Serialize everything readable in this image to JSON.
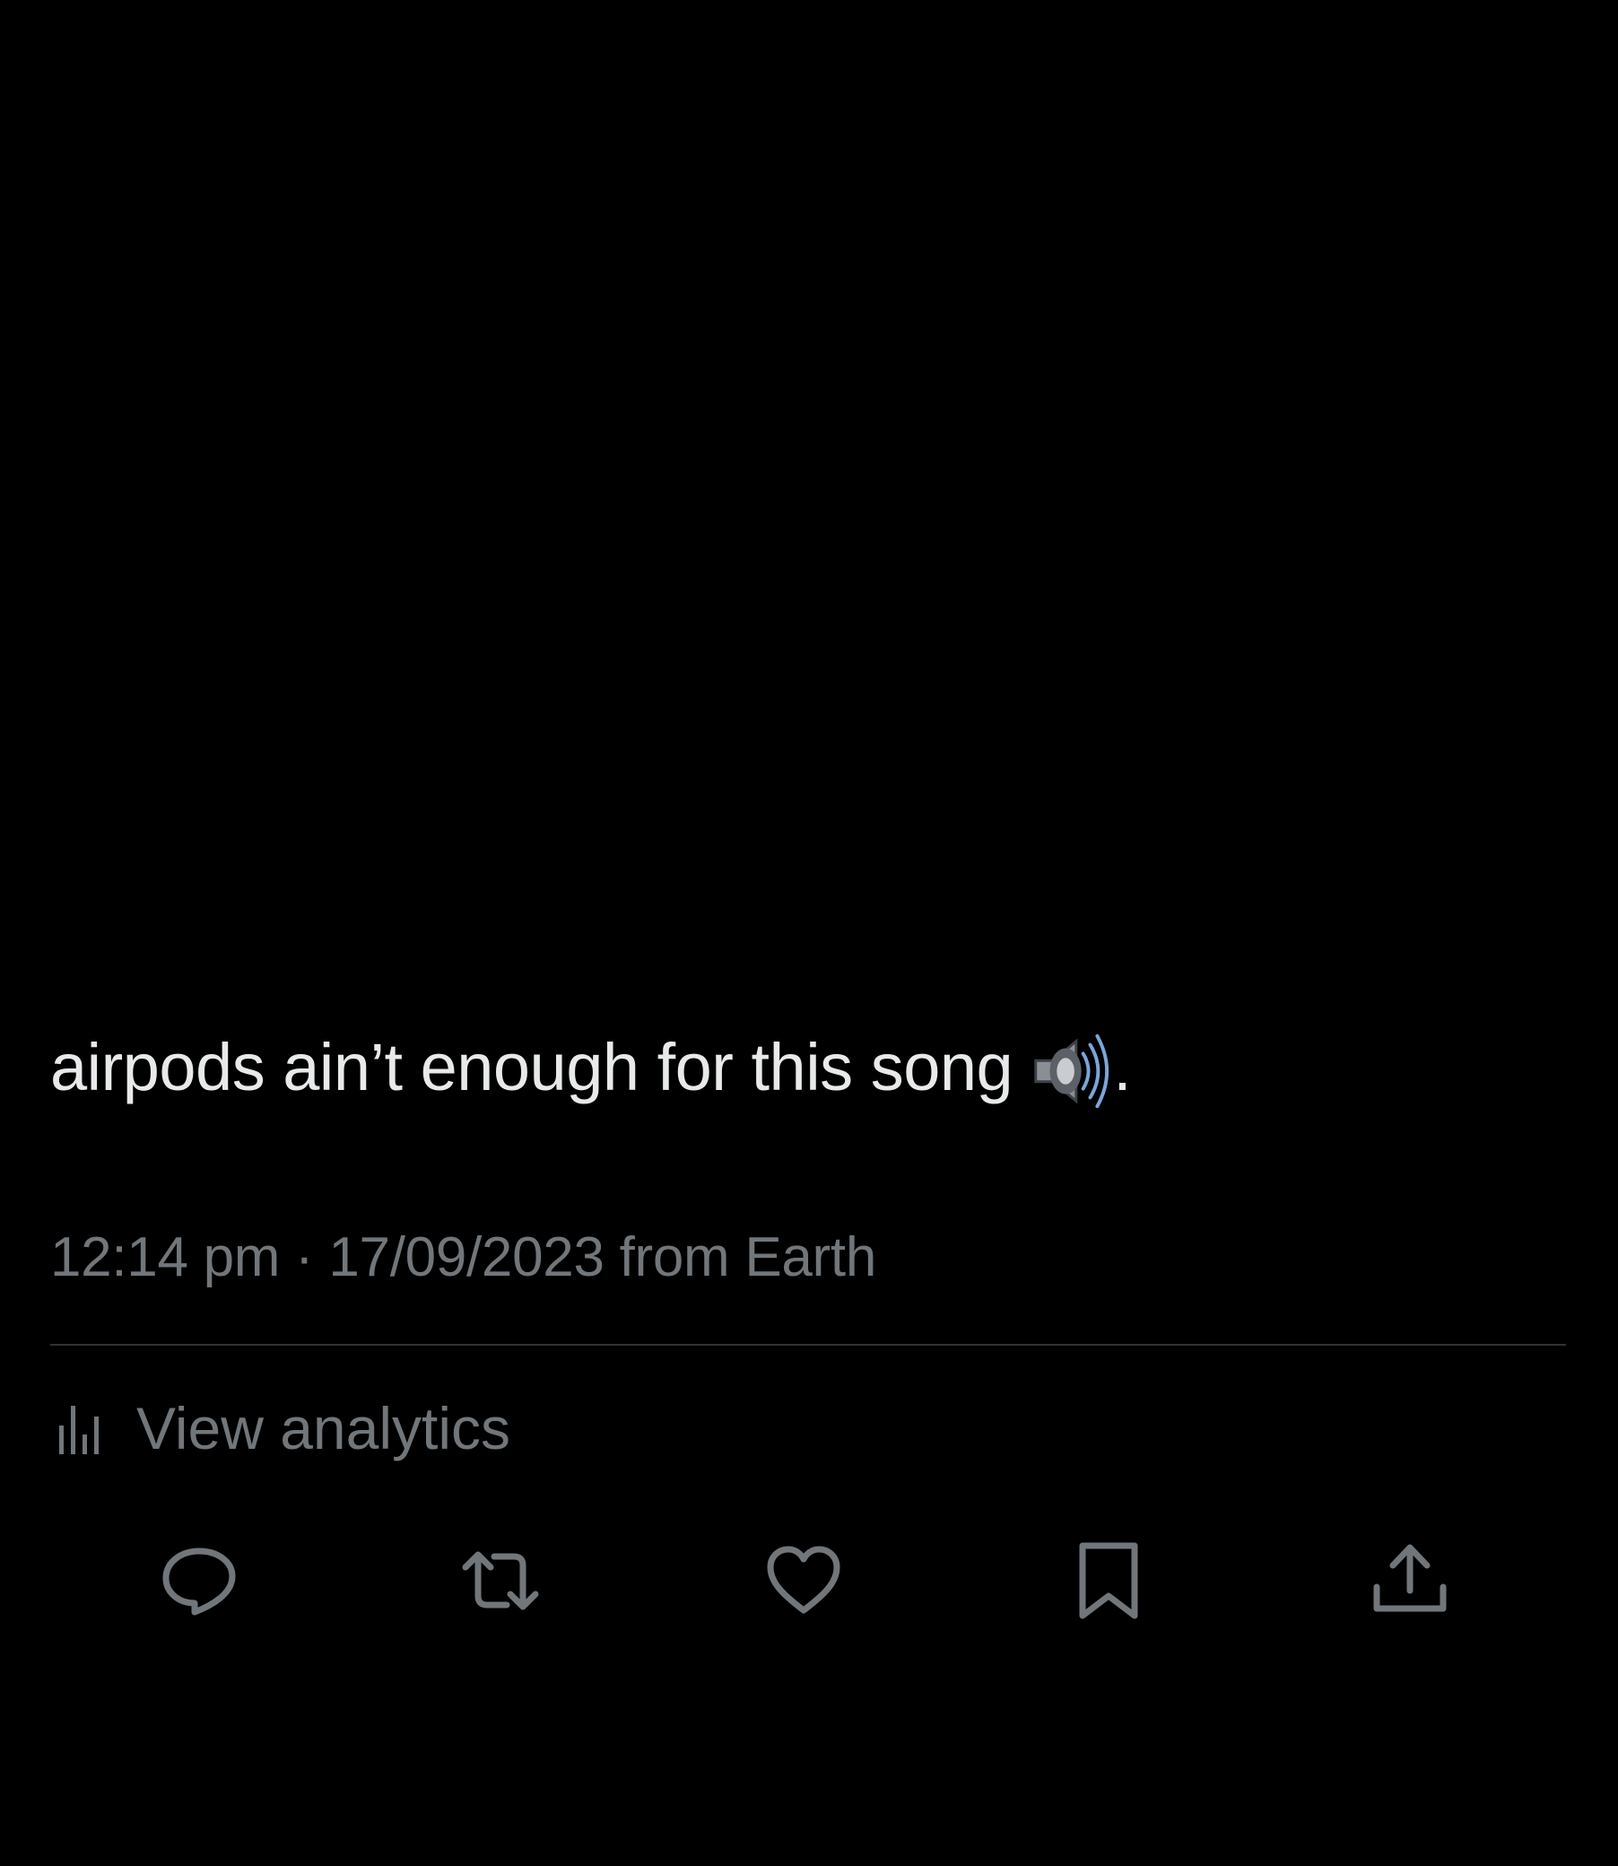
{
  "tweet": {
    "text": "airpods ain’t enough for this song",
    "emoji": "speaker-high-volume",
    "trailing_punctuation": ".",
    "time": "12:14 pm",
    "separator": "·",
    "date": "17/09/2023",
    "source": "from Earth"
  },
  "analytics": {
    "label": "View analytics",
    "icon": "analytics-bars-icon"
  },
  "actions": [
    {
      "name": "reply",
      "icon": "reply-icon"
    },
    {
      "name": "repost",
      "icon": "repost-icon"
    },
    {
      "name": "like",
      "icon": "heart-icon"
    },
    {
      "name": "bookmark",
      "icon": "bookmark-icon"
    },
    {
      "name": "share",
      "icon": "share-icon"
    }
  ],
  "colors": {
    "background": "#000000",
    "primary_text": "#e7e9ea",
    "secondary_text": "#71767b",
    "divider": "#2f3336"
  }
}
